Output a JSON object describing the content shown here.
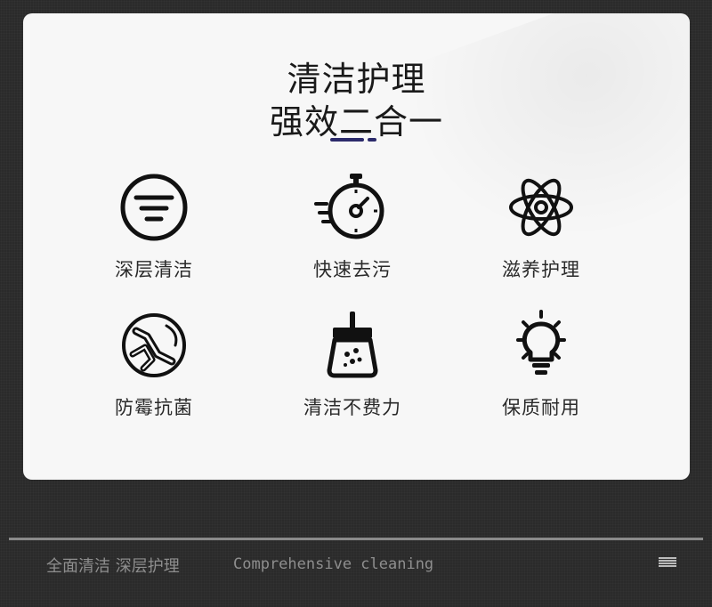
{
  "card": {
    "title_line1": "清洁护理",
    "title_line2": "强效二合一",
    "accent_color": "#2b2a6b"
  },
  "features": [
    {
      "label": "深层清洁",
      "icon": "filter-circle-icon"
    },
    {
      "label": "快速去污",
      "icon": "stopwatch-icon"
    },
    {
      "label": "滋养护理",
      "icon": "atom-icon"
    },
    {
      "label": "防霉抗菌",
      "icon": "bacteria-icon"
    },
    {
      "label": "清洁不费力",
      "icon": "brush-icon"
    },
    {
      "label": "保质耐用",
      "icon": "lightbulb-icon"
    }
  ],
  "footer": {
    "cn_text": "全面清洁 深层护理",
    "en_text": "Comprehensive cleaning",
    "menu_icon": "menu-icon"
  }
}
